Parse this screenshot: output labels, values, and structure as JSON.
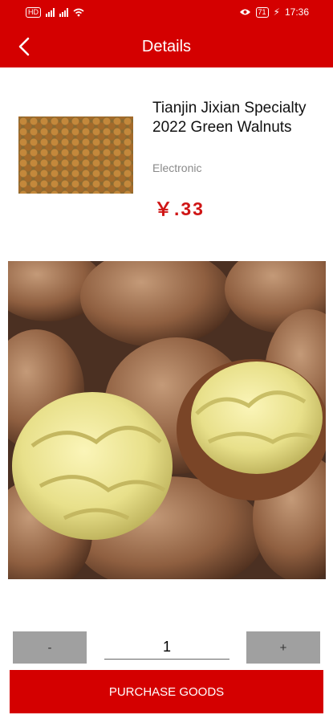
{
  "status_bar": {
    "left_badge": "HD",
    "time": "17:36",
    "battery_level": "71"
  },
  "header": {
    "title": "Details"
  },
  "product": {
    "name": "Tianjin Jixian Specialty 2022 Green Walnuts",
    "type": "Electronic",
    "price": "￥.33"
  },
  "quantity": {
    "minus_label": "-",
    "value": "1",
    "plus_label": "+"
  },
  "purchase": {
    "label": "PURCHASE GOODS"
  },
  "colors": {
    "brand_red": "#d40000",
    "price_red": "#cf1515",
    "button_gray": "#a0a0a0"
  }
}
